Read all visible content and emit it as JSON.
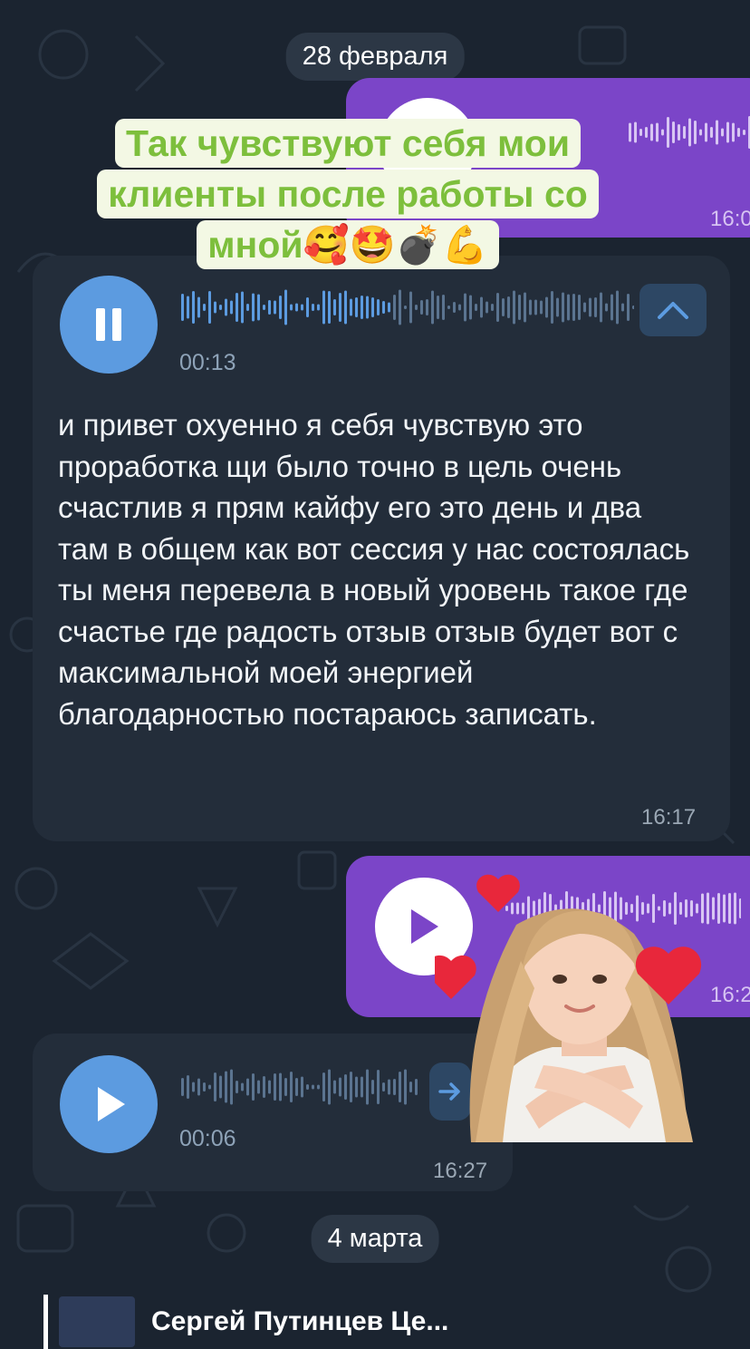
{
  "dates": {
    "first": "28 февраля",
    "second": "4 марта"
  },
  "caption": {
    "line1": "Так чувствуют себя мои",
    "line2": "клиенты после работы со",
    "line3": "мной🥰🤩💣💪"
  },
  "messages": [
    {
      "id": "out-voice-1",
      "direction": "outgoing",
      "time": "16:0"
    },
    {
      "id": "in-voice-1",
      "direction": "incoming",
      "duration": "00:13",
      "time": "16:17",
      "state": "playing",
      "transcript": "и привет охуенно я себя чувствую это проработка щи было точно в цель очень счастлив я прям кайфу его это день и два там в общем как вот сессия у нас состоялась ты меня перевела в новый уровень такое где счастье где радость отзыв отзыв будет вот с максимальной моей энергией благодарностью постараюсь записать."
    },
    {
      "id": "out-voice-2",
      "direction": "outgoing",
      "time": "16:2",
      "state": "paused"
    },
    {
      "id": "in-voice-2",
      "direction": "incoming",
      "duration": "00:06",
      "time": "16:27",
      "state": "paused"
    }
  ],
  "quote": {
    "title": "Сергей Путинцев Це..."
  },
  "icons": {
    "pause": "pause-icon",
    "play": "play-icon",
    "collapse": "chevron-up-icon",
    "forward": "forward-arrow-icon",
    "sticker": "girl-hearts-sticker"
  },
  "colors": {
    "background": "#1b2430",
    "incoming_bubble": "#232d3a",
    "outgoing_bubble": "#7b45c8",
    "accent_blue": "#5c9be0",
    "caption_green": "#7dbf3c",
    "caption_bg": "#f3f8e4"
  }
}
